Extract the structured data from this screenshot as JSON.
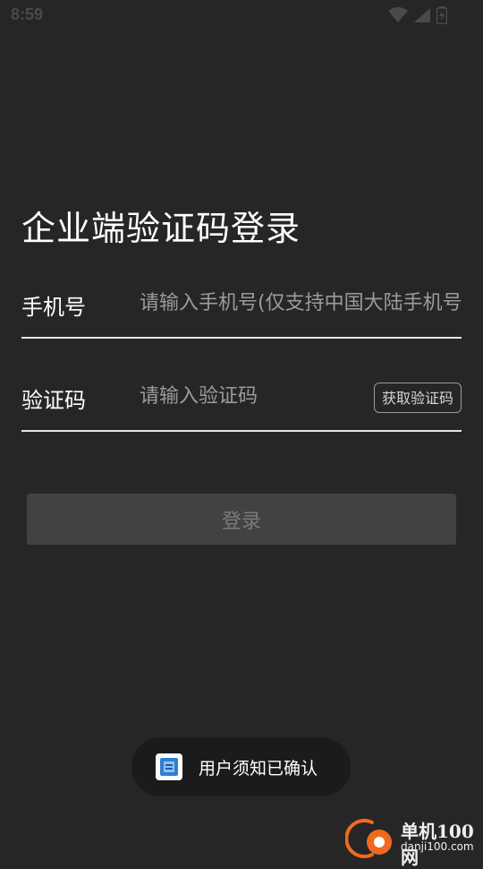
{
  "status_bar": {
    "time": "8:59",
    "icons": [
      "wifi-icon",
      "signal-icon",
      "battery-icon"
    ]
  },
  "title": "企业端验证码登录",
  "phone_field": {
    "label": "手机号",
    "placeholder": "请输入手机号(仅支持中国大陆手机号)",
    "value": ""
  },
  "code_field": {
    "label": "验证码",
    "placeholder": "请输入验证码",
    "value": "",
    "get_code_label": "获取验证码"
  },
  "login_button": {
    "label": "登录"
  },
  "toast": {
    "text": "用户须知已确认",
    "icon": "app-icon"
  },
  "watermark": {
    "name": "单机100网",
    "url": "danji100.com"
  },
  "colors": {
    "background": "#262626",
    "login_disabled": "#424242",
    "underline": "#e6e6e6",
    "toast_bg": "#1b1b1b",
    "watermark_accent": "#f06a1e"
  }
}
